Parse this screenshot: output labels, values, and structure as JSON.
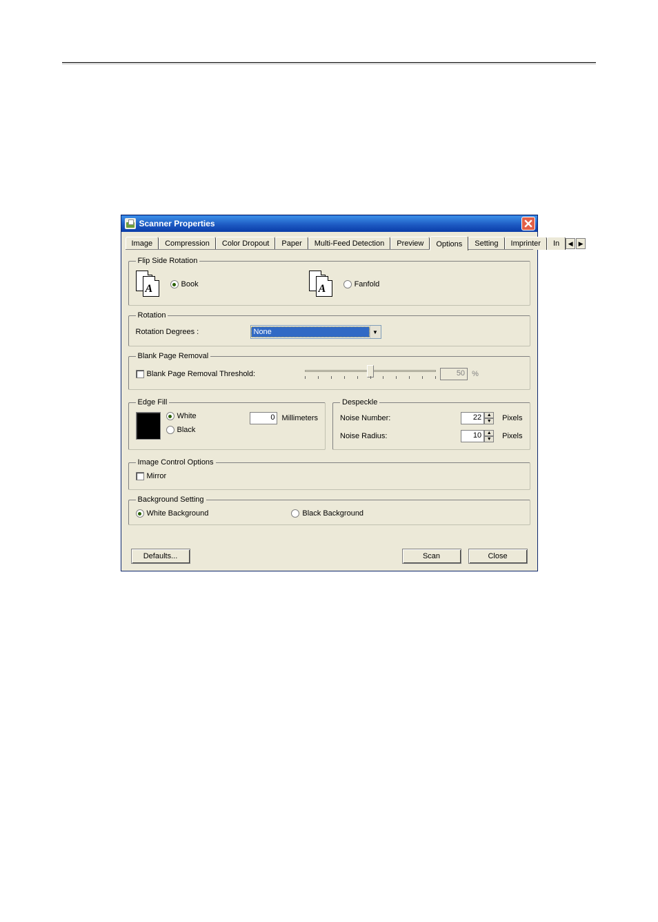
{
  "window": {
    "title": "Scanner Properties"
  },
  "tabs": [
    "Image",
    "Compression",
    "Color Dropout",
    "Paper",
    "Multi-Feed Detection",
    "Preview",
    "Options",
    "Setting",
    "Imprinter",
    "In"
  ],
  "active_tab_index": 6,
  "flip_side_rotation": {
    "legend": "Flip Side Rotation",
    "book_label": "Book",
    "fanfold_label": "Fanfold",
    "selected": "book"
  },
  "rotation": {
    "legend": "Rotation",
    "label": "Rotation Degrees :",
    "value": "None"
  },
  "blank_page": {
    "legend": "Blank Page Removal",
    "checkbox_label": "Blank Page Removal Threshold:",
    "value": "50",
    "unit": "%"
  },
  "edge_fill": {
    "legend": "Edge Fill",
    "white_label": "White",
    "black_label": "Black",
    "selected": "white",
    "value": "0",
    "unit": "Millimeters"
  },
  "despeckle": {
    "legend": "Despeckle",
    "noise_number_label": "Noise Number:",
    "noise_number_value": "22",
    "noise_radius_label": "Noise Radius:",
    "noise_radius_value": "10",
    "unit": "Pixels"
  },
  "image_control": {
    "legend": "Image Control Options",
    "mirror_label": "Mirror"
  },
  "background": {
    "legend": "Background Setting",
    "white_label": "White Background",
    "black_label": "Black Background",
    "selected": "white"
  },
  "buttons": {
    "defaults": "Defaults...",
    "scan": "Scan",
    "close": "Close"
  }
}
